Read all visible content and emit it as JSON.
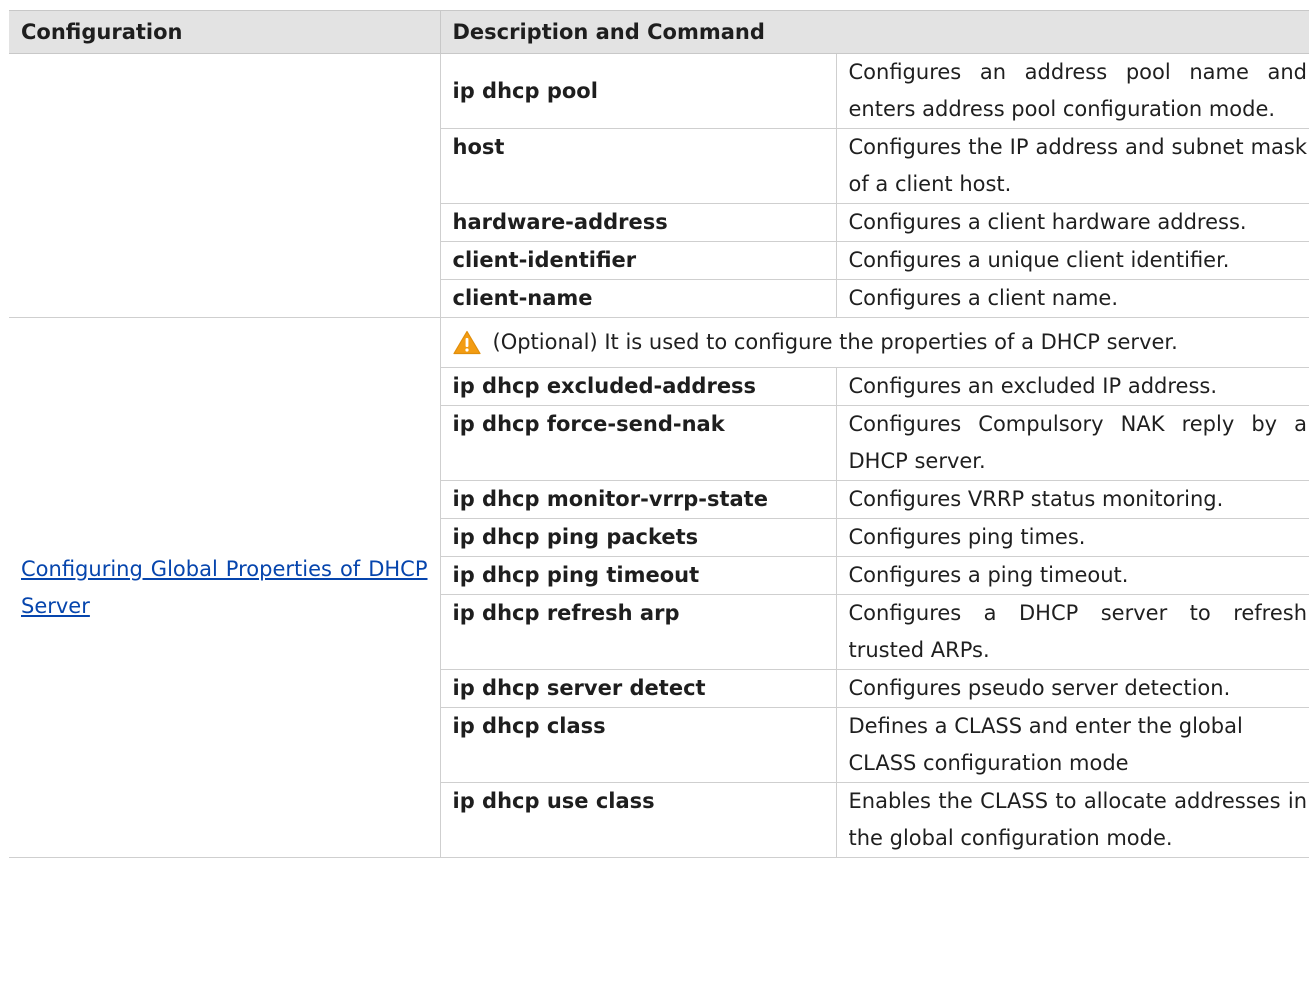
{
  "headers": {
    "configuration": "Configuration",
    "description_and_command": "Description and Command"
  },
  "group1": {
    "configuration": "",
    "rows": [
      {
        "command": "ip dhcp pool",
        "description": "Configures an address pool name and enters address pool configuration mode."
      },
      {
        "command": "host",
        "description": "Configures the IP address and subnet mask of a client host."
      },
      {
        "command": "hardware-address",
        "description": "Configures a client hardware address."
      },
      {
        "command": "client-identifier",
        "description": "Configures a unique client identifier."
      },
      {
        "command": "client-name",
        "description": "Configures a client name."
      }
    ]
  },
  "group2": {
    "configuration_link": "Configuring Global Properties of DHCP Server",
    "caution_icon": "warning-triangle-icon",
    "caution_text": "(Optional) It is used to configure the properties of a DHCP server.",
    "rows": [
      {
        "command": "ip dhcp excluded-address",
        "description": "Configures an excluded IP address."
      },
      {
        "command": "ip dhcp force-send-nak",
        "description": "Configures Compulsory NAK reply by a DHCP server."
      },
      {
        "command": "ip dhcp monitor-vrrp-state",
        "description": "Configures VRRP status monitoring."
      },
      {
        "command": "ip dhcp ping packets",
        "description": "Configures ping times."
      },
      {
        "command": "ip dhcp ping timeout",
        "description": "Configures a ping timeout."
      },
      {
        "command": "ip dhcp refresh arp",
        "description": "Configures a DHCP server to refresh trusted ARPs."
      },
      {
        "command": "ip dhcp server detect",
        "description": "Configures pseudo server detection."
      },
      {
        "command": "ip dhcp class",
        "description": "Defines a CLASS and enter the global CLASS configuration mode"
      },
      {
        "command": "ip dhcp use class",
        "description": "Enables the CLASS to allocate addresses in the global configuration mode."
      }
    ]
  },
  "colors": {
    "header_bg": "#e3e3e3",
    "link": "#0645ad",
    "warning_fill": "#f39c12"
  }
}
